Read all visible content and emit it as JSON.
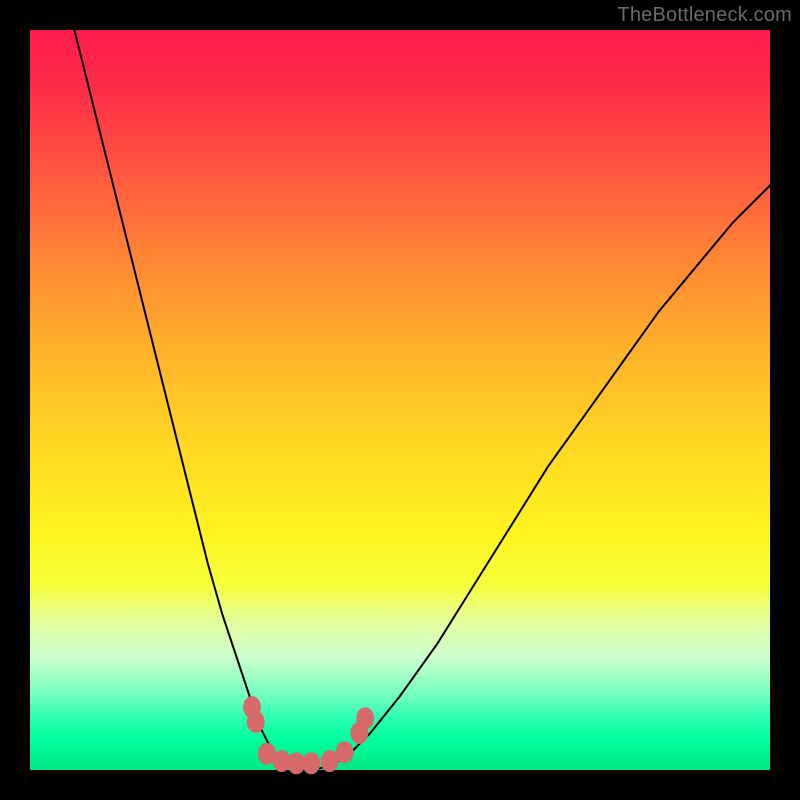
{
  "watermark": "TheBottleneck.com",
  "colors": {
    "page_bg": "#000000",
    "text": "#6a6a6a",
    "curve": "#000000",
    "blob": "#d66a6a"
  },
  "chart_data": {
    "type": "line",
    "title": "",
    "xlabel": "",
    "ylabel": "",
    "xlim": [
      0,
      100
    ],
    "ylim": [
      0,
      100
    ],
    "series": [
      {
        "name": "left-branch",
        "x": [
          6,
          8,
          10,
          12,
          14,
          16,
          18,
          20,
          22,
          24,
          26,
          28,
          30,
          31,
          32,
          33,
          34,
          35
        ],
        "y": [
          100,
          92,
          84,
          76,
          68,
          60,
          52,
          44,
          36,
          28,
          21,
          15,
          9,
          6,
          4,
          2.2,
          1.2,
          0.6
        ]
      },
      {
        "name": "valley-floor",
        "x": [
          35,
          36,
          37,
          38,
          39,
          40,
          41
        ],
        "y": [
          0.6,
          0.2,
          0.1,
          0.1,
          0.2,
          0.4,
          0.8
        ]
      },
      {
        "name": "right-branch",
        "x": [
          41,
          43,
          46,
          50,
          55,
          60,
          65,
          70,
          75,
          80,
          85,
          90,
          95,
          100
        ],
        "y": [
          0.8,
          2,
          5,
          10,
          17,
          25,
          33,
          41,
          48,
          55,
          62,
          68,
          74,
          79
        ]
      }
    ],
    "markers": [
      {
        "x_pct": 30.0,
        "y_from_bottom_pct": 8.5
      },
      {
        "x_pct": 30.5,
        "y_from_bottom_pct": 6.5
      },
      {
        "x_pct": 32.0,
        "y_from_bottom_pct": 2.2
      },
      {
        "x_pct": 34.0,
        "y_from_bottom_pct": 1.2
      },
      {
        "x_pct": 36.0,
        "y_from_bottom_pct": 0.9
      },
      {
        "x_pct": 38.0,
        "y_from_bottom_pct": 0.9
      },
      {
        "x_pct": 40.5,
        "y_from_bottom_pct": 1.2
      },
      {
        "x_pct": 42.5,
        "y_from_bottom_pct": 2.4
      },
      {
        "x_pct": 44.5,
        "y_from_bottom_pct": 5.0
      },
      {
        "x_pct": 45.3,
        "y_from_bottom_pct": 7.0
      }
    ]
  }
}
